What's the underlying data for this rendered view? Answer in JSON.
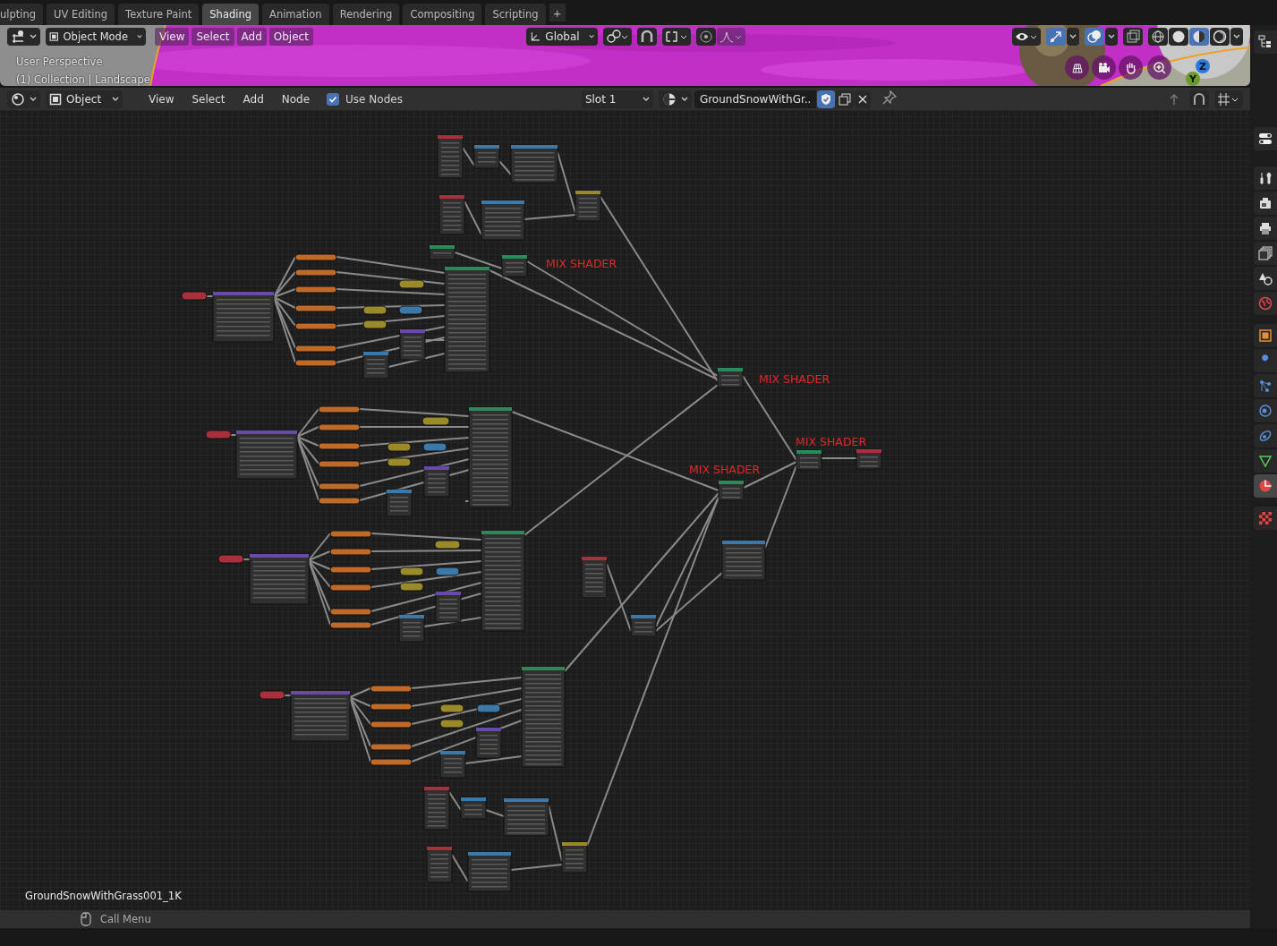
{
  "workspace_tabs": [
    {
      "label": "ulpting",
      "selected": false
    },
    {
      "label": "UV Editing",
      "selected": false
    },
    {
      "label": "Texture Paint",
      "selected": false
    },
    {
      "label": "Shading",
      "selected": true
    },
    {
      "label": "Animation",
      "selected": false
    },
    {
      "label": "Rendering",
      "selected": false
    },
    {
      "label": "Compositing",
      "selected": false
    },
    {
      "label": "Scripting",
      "selected": false
    }
  ],
  "add_workspace": "+",
  "viewport": {
    "editor_mode": "Object Mode",
    "menus": [
      "View",
      "Select",
      "Add",
      "Object"
    ],
    "orientation": "Global",
    "info": [
      "User Perspective",
      "(1) Collection | Landscape"
    ],
    "shading": [
      {
        "kind": "wireframe",
        "selected": false
      },
      {
        "kind": "solid",
        "selected": false
      },
      {
        "kind": "material",
        "selected": true
      },
      {
        "kind": "rendered",
        "selected": false
      }
    ],
    "gizmo_axes": [
      "Z",
      "Y"
    ]
  },
  "node_editor": {
    "editor_object": "Object",
    "menus": [
      "View",
      "Select",
      "Add",
      "Node"
    ],
    "use_nodes": {
      "label": "Use Nodes",
      "checked": true
    },
    "slot": "Slot 1",
    "material": "GroundSnowWithGr..",
    "fake_user": true,
    "frame_labels": [
      "MIX SHADER",
      "MIX SHADER",
      "MIX SHADER",
      "MIX SHADER"
    ],
    "material_name": "GroundSnowWithGrass001_1K"
  },
  "properties_tabs": [
    {
      "kind": "tool",
      "selected": false
    },
    {
      "kind": "render",
      "selected": false
    },
    {
      "kind": "output",
      "selected": false
    },
    {
      "kind": "view_layer",
      "selected": false
    },
    {
      "kind": "scene",
      "selected": false
    },
    {
      "kind": "world",
      "selected": false
    },
    {
      "kind": "object",
      "selected": false
    },
    {
      "kind": "modifier",
      "selected": false
    },
    {
      "kind": "particles",
      "selected": false
    },
    {
      "kind": "physics",
      "selected": false
    },
    {
      "kind": "constraints",
      "selected": false
    },
    {
      "kind": "data",
      "selected": false
    },
    {
      "kind": "material",
      "selected": true
    },
    {
      "kind": "texture",
      "selected": false
    }
  ],
  "status_bar": {
    "hint": "Call Menu"
  }
}
